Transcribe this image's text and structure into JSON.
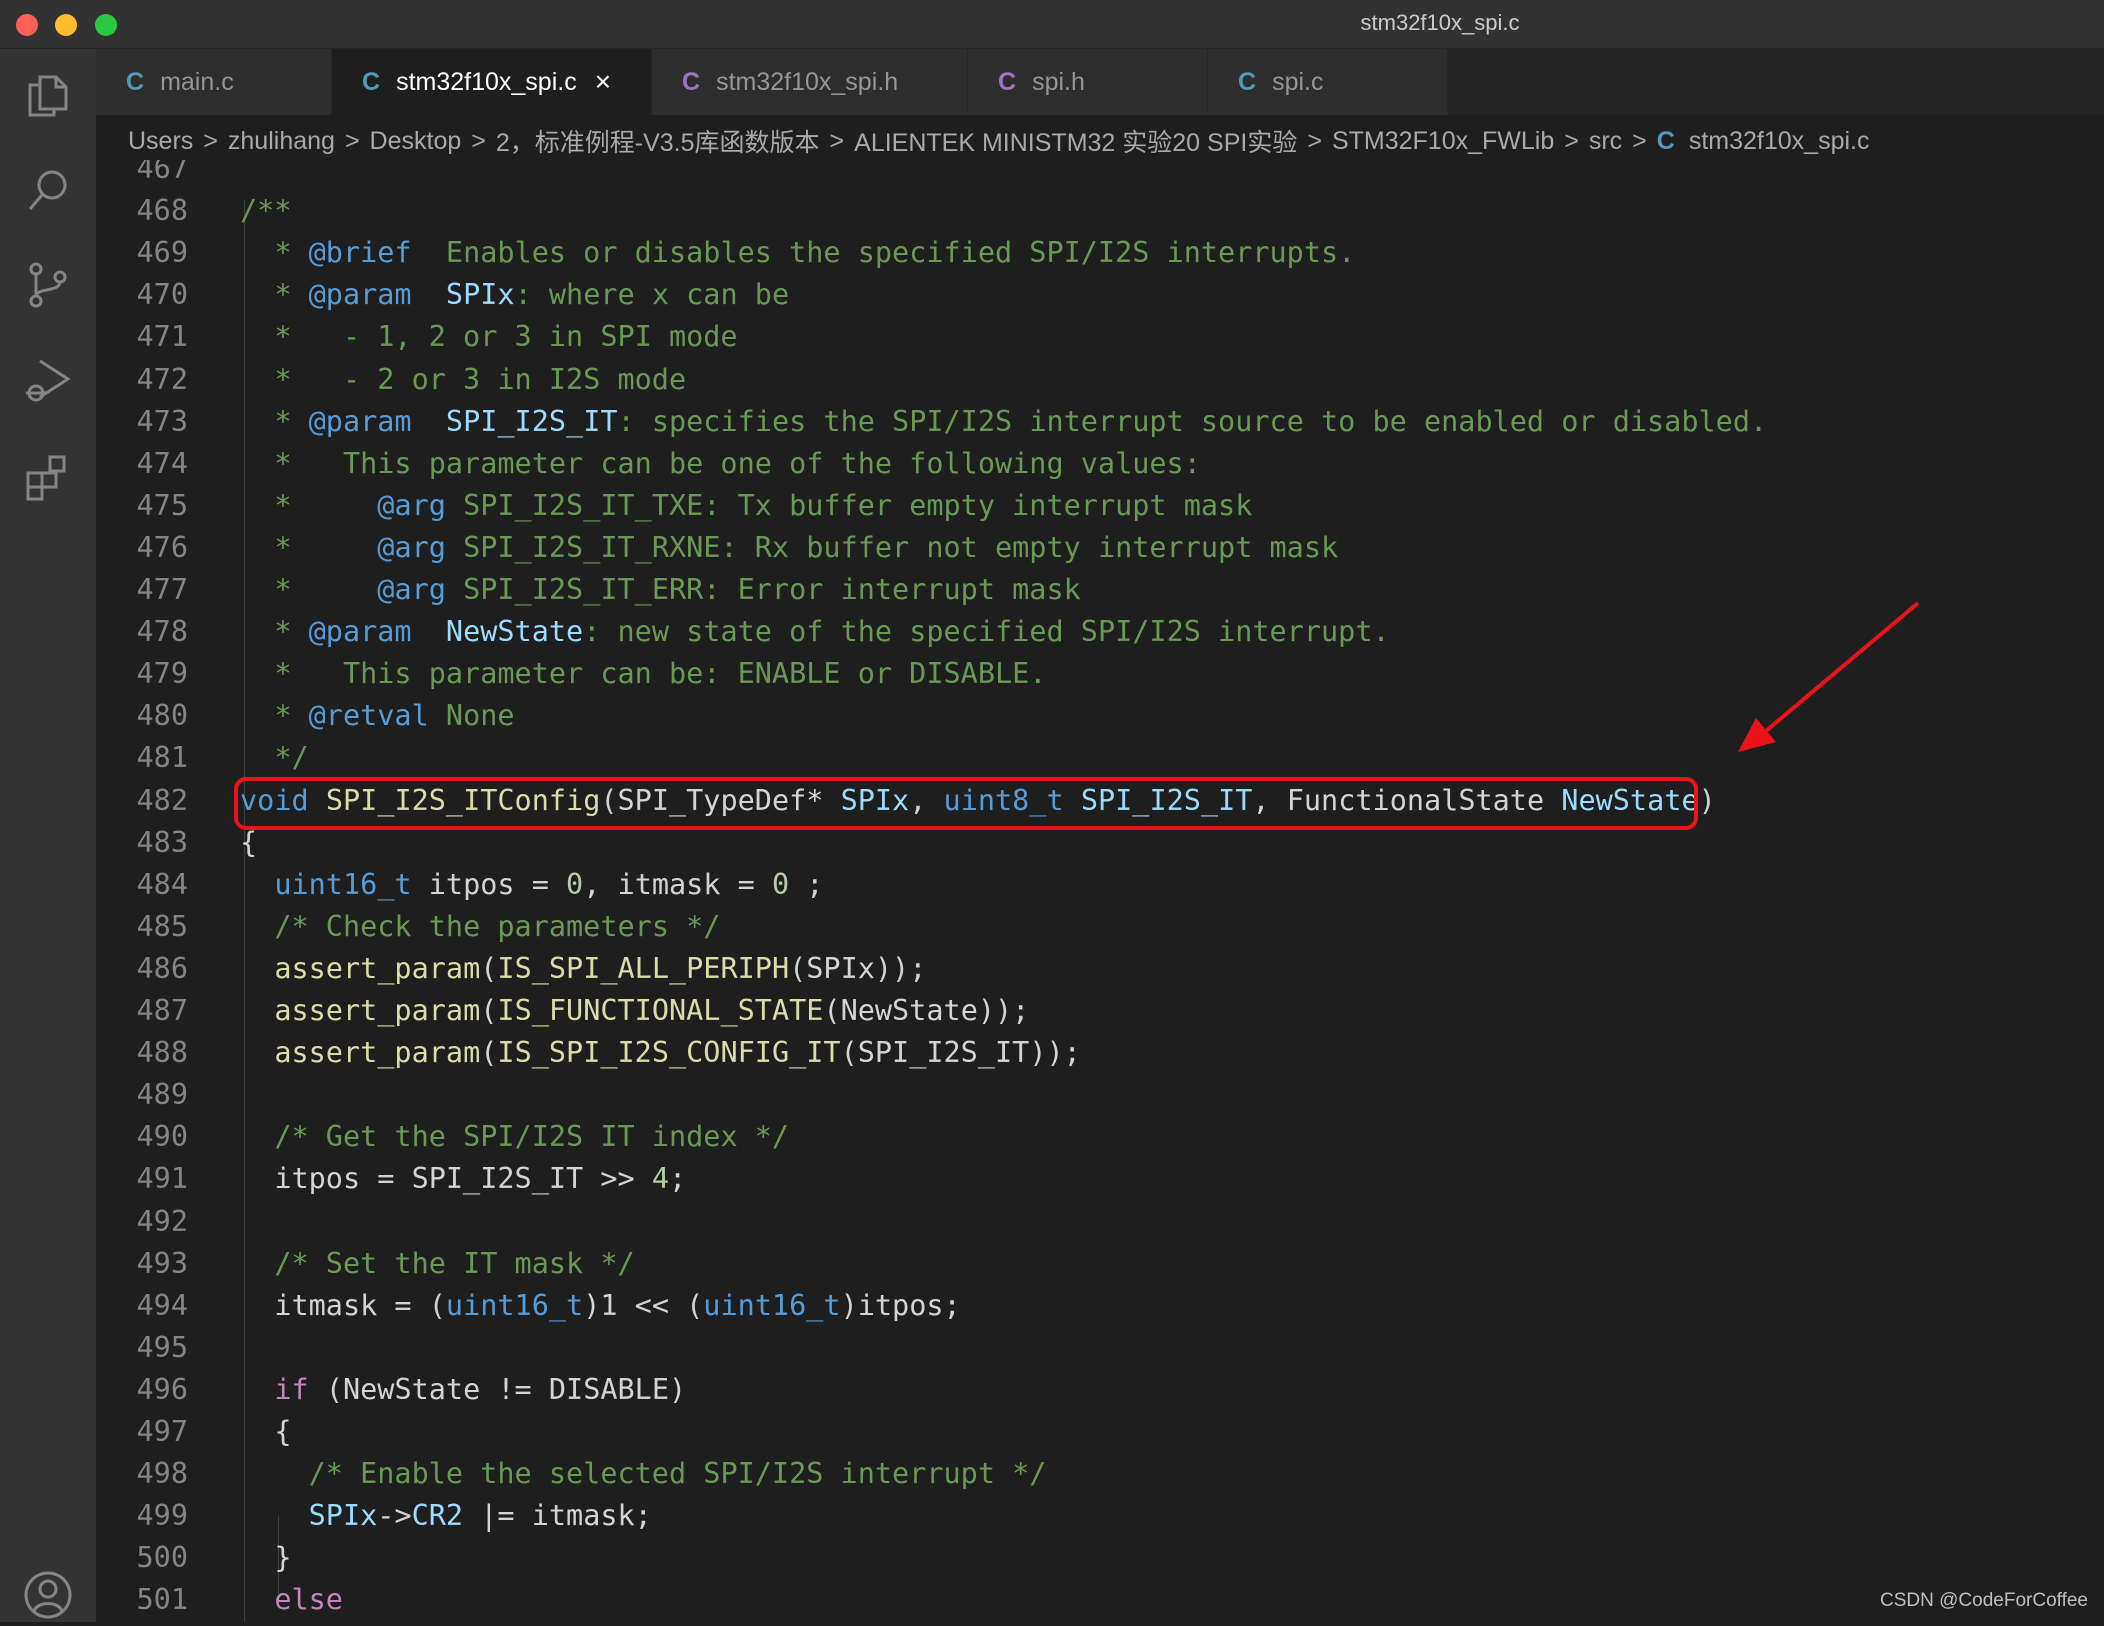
{
  "window": {
    "title": "stm32f10x_spi.c"
  },
  "activity_bar": {
    "icons": [
      "files-icon",
      "search-icon",
      "source-control-icon",
      "run-debug-icon",
      "extensions-icon",
      "account-icon"
    ]
  },
  "tabs": [
    {
      "icon": "C",
      "label": "main.c",
      "active": false
    },
    {
      "icon": "C",
      "label": "stm32f10x_spi.c",
      "active": true,
      "close": "×"
    },
    {
      "icon": "C",
      "label": "stm32f10x_spi.h",
      "active": false
    },
    {
      "icon": "C",
      "label": "spi.h",
      "active": false
    },
    {
      "icon": "C",
      "label": "spi.c",
      "active": false
    }
  ],
  "breadcrumb": {
    "items": [
      "Users",
      "zhulihang",
      "Desktop",
      "2，标准例程-V3.5库函数版本",
      "ALIENTEK MINISTM32 实验20 SPI实验",
      "STM32F10x_FWLib",
      "src"
    ],
    "file_icon": "C",
    "file": "stm32f10x_spi.c",
    "separator": ">"
  },
  "editor": {
    "lines": [
      {
        "n": "467",
        "tokens": []
      },
      {
        "n": "468",
        "tokens": [
          [
            "cm",
            "/**"
          ]
        ]
      },
      {
        "n": "469",
        "tokens": [
          [
            "cm",
            "  * "
          ],
          [
            "tag",
            "@brief"
          ],
          [
            "cm",
            "  Enables or disables the specified SPI/I2S interrupts."
          ]
        ]
      },
      {
        "n": "470",
        "tokens": [
          [
            "cm",
            "  * "
          ],
          [
            "tag",
            "@param"
          ],
          [
            "cm",
            "  "
          ],
          [
            "p",
            "SPIx"
          ],
          [
            "cm",
            ": where x can be"
          ]
        ]
      },
      {
        "n": "471",
        "tokens": [
          [
            "cm",
            "  *   - 1, 2 or 3 in SPI mode"
          ]
        ]
      },
      {
        "n": "472",
        "tokens": [
          [
            "cm",
            "  *   - 2 or 3 in I2S mode"
          ]
        ]
      },
      {
        "n": "473",
        "tokens": [
          [
            "cm",
            "  * "
          ],
          [
            "tag",
            "@param"
          ],
          [
            "cm",
            "  "
          ],
          [
            "p",
            "SPI_I2S_IT"
          ],
          [
            "cm",
            ": specifies the SPI/I2S interrupt source to be enabled or disabled."
          ]
        ]
      },
      {
        "n": "474",
        "tokens": [
          [
            "cm",
            "  *   This parameter can be one of the following values:"
          ]
        ]
      },
      {
        "n": "475",
        "tokens": [
          [
            "cm",
            "  *     "
          ],
          [
            "tag",
            "@arg"
          ],
          [
            "cm",
            " SPI_I2S_IT_TXE: Tx buffer empty interrupt mask"
          ]
        ]
      },
      {
        "n": "476",
        "tokens": [
          [
            "cm",
            "  *     "
          ],
          [
            "tag",
            "@arg"
          ],
          [
            "cm",
            " SPI_I2S_IT_RXNE: Rx buffer not empty interrupt mask"
          ]
        ]
      },
      {
        "n": "477",
        "tokens": [
          [
            "cm",
            "  *     "
          ],
          [
            "tag",
            "@arg"
          ],
          [
            "cm",
            " SPI_I2S_IT_ERR: Error interrupt mask"
          ]
        ]
      },
      {
        "n": "478",
        "tokens": [
          [
            "cm",
            "  * "
          ],
          [
            "tag",
            "@param"
          ],
          [
            "cm",
            "  "
          ],
          [
            "p",
            "NewState"
          ],
          [
            "cm",
            ": new state of the specified SPI/I2S interrupt."
          ]
        ]
      },
      {
        "n": "479",
        "tokens": [
          [
            "cm",
            "  *   This parameter can be: ENABLE or DISABLE."
          ]
        ]
      },
      {
        "n": "480",
        "tokens": [
          [
            "cm",
            "  * "
          ],
          [
            "tag",
            "@retval"
          ],
          [
            "cm",
            " None"
          ]
        ]
      },
      {
        "n": "481",
        "tokens": [
          [
            "cm",
            "  */"
          ]
        ]
      },
      {
        "n": "482",
        "tokens": [
          [
            "k",
            "void"
          ],
          [
            "tx",
            " "
          ],
          [
            "f",
            "SPI_I2S_ITConfig"
          ],
          [
            "tx",
            "(SPI_TypeDef* "
          ],
          [
            "p",
            "SPIx"
          ],
          [
            "tx",
            ", "
          ],
          [
            "k",
            "uint8_t"
          ],
          [
            "tx",
            " "
          ],
          [
            "p",
            "SPI_I2S_IT"
          ],
          [
            "tx",
            ", FunctionalState "
          ],
          [
            "p",
            "NewState"
          ],
          [
            "tx",
            ")"
          ]
        ]
      },
      {
        "n": "483",
        "tokens": [
          [
            "tx",
            "{"
          ]
        ]
      },
      {
        "n": "484",
        "tokens": [
          [
            "tx",
            "  "
          ],
          [
            "k",
            "uint16_t"
          ],
          [
            "tx",
            " itpos = "
          ],
          [
            "n",
            "0"
          ],
          [
            "tx",
            ", itmask = "
          ],
          [
            "n",
            "0"
          ],
          [
            "tx",
            " ;"
          ]
        ]
      },
      {
        "n": "485",
        "tokens": [
          [
            "tx",
            "  "
          ],
          [
            "cm",
            "/* Check the parameters */"
          ]
        ]
      },
      {
        "n": "486",
        "tokens": [
          [
            "tx",
            "  "
          ],
          [
            "f",
            "assert_param"
          ],
          [
            "tx",
            "("
          ],
          [
            "f",
            "IS_SPI_ALL_PERIPH"
          ],
          [
            "tx",
            "(SPIx));"
          ]
        ]
      },
      {
        "n": "487",
        "tokens": [
          [
            "tx",
            "  "
          ],
          [
            "f",
            "assert_param"
          ],
          [
            "tx",
            "("
          ],
          [
            "f",
            "IS_FUNCTIONAL_STATE"
          ],
          [
            "tx",
            "(NewState));"
          ]
        ]
      },
      {
        "n": "488",
        "tokens": [
          [
            "tx",
            "  "
          ],
          [
            "f",
            "assert_param"
          ],
          [
            "tx",
            "("
          ],
          [
            "f",
            "IS_SPI_I2S_CONFIG_IT"
          ],
          [
            "tx",
            "(SPI_I2S_IT));"
          ]
        ]
      },
      {
        "n": "489",
        "tokens": []
      },
      {
        "n": "490",
        "tokens": [
          [
            "tx",
            "  "
          ],
          [
            "cm",
            "/* Get the SPI/I2S IT index */"
          ]
        ]
      },
      {
        "n": "491",
        "tokens": [
          [
            "tx",
            "  itpos = SPI_I2S_IT >> "
          ],
          [
            "n",
            "4"
          ],
          [
            "tx",
            ";"
          ]
        ]
      },
      {
        "n": "492",
        "tokens": []
      },
      {
        "n": "493",
        "tokens": [
          [
            "tx",
            "  "
          ],
          [
            "cm",
            "/* Set the IT mask */"
          ]
        ]
      },
      {
        "n": "494",
        "tokens": [
          [
            "tx",
            "  itmask = ("
          ],
          [
            "k",
            "uint16_t"
          ],
          [
            "tx",
            ")1 << ("
          ],
          [
            "k",
            "uint16_t"
          ],
          [
            "tx",
            ")itpos;"
          ]
        ]
      },
      {
        "n": "495",
        "tokens": []
      },
      {
        "n": "496",
        "tokens": [
          [
            "tx",
            "  "
          ],
          [
            "m",
            "if"
          ],
          [
            "tx",
            " (NewState != DISABLE)"
          ]
        ]
      },
      {
        "n": "497",
        "tokens": [
          [
            "tx",
            "  {"
          ]
        ]
      },
      {
        "n": "498",
        "tokens": [
          [
            "tx",
            "    "
          ],
          [
            "cm",
            "/* Enable the selected SPI/I2S interrupt */"
          ]
        ]
      },
      {
        "n": "499",
        "tokens": [
          [
            "tx",
            "    "
          ],
          [
            "p",
            "SPIx"
          ],
          [
            "tx",
            "->"
          ],
          [
            "p",
            "CR2"
          ],
          [
            "tx",
            " |= itmask;"
          ]
        ]
      },
      {
        "n": "500",
        "tokens": [
          [
            "tx",
            "  }"
          ]
        ]
      },
      {
        "n": "501",
        "tokens": [
          [
            "tx",
            "  "
          ],
          [
            "m",
            "else"
          ]
        ]
      }
    ]
  },
  "annotation": {
    "color": "#e8141a"
  },
  "watermark": "CSDN @CodeForCoffee"
}
